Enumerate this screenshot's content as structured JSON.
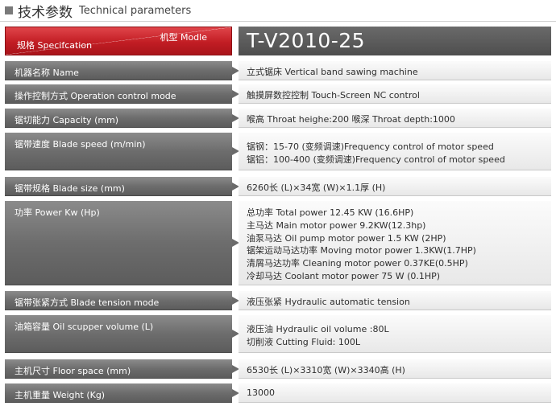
{
  "header": {
    "title_cn": "技术参数",
    "title_en": "Technical parameters"
  },
  "table": {
    "model_label": "机型 Modle",
    "spec_label": "规格 Specifcation",
    "model_name": "T-V2010-25",
    "rows": [
      {
        "label": "机器名称 Name",
        "values": [
          "立式锯床 Vertical band sawing machine"
        ]
      },
      {
        "label": "操作控制方式 Operation control mode",
        "values": [
          "触摸屏数控控制 Touch-Screen NC control"
        ]
      },
      {
        "label": "锯切能力 Capacity (mm)",
        "values": [
          "喉高 Throat heighe:200    喉深 Throat depth:1000"
        ]
      },
      {
        "label": "锯带速度 Blade speed (m/min)",
        "values": [
          "锯钢：15-70 (变频调速)Frequency control of motor speed",
          "锯铝：100-400 (变频调速)Frequency control of motor speed"
        ]
      },
      {
        "label": "锯带规格 Blade size (mm)",
        "values": [
          "6260长 (L)×34宽 (W)×1.1厚 (H)"
        ]
      },
      {
        "label": "功率 Power Kw (Hp)",
        "values": [
          "总功率 Total power 12.45 KW (16.6HP)",
          "主马达 Main motor power 9.2KW(12.3hp)",
          "油泵马达 Oil pump motor power 1.5 KW (2HP)",
          "锯架运动马达功率 Moving motor power 1.3KW(1.7HP)",
          "清屑马达功率 Cleaning motor power 0.37KE(0.5HP)",
          "冷却马达 Coolant motor power 75   W (0.1HP)"
        ]
      },
      {
        "label": "锯带张紧方式 Blade tension mode",
        "values": [
          "液压张紧 Hydraulic automatic tension"
        ]
      },
      {
        "label": "油箱容量 Oil scupper volume (L)",
        "values": [
          "液压油 Hydraulic oil volume :80L",
          "切削液 Cutting Fluid: 100L"
        ]
      },
      {
        "label": "主机尺寸 Floor space (mm)",
        "values": [
          "6530长 (L)×3310宽 (W)×3340高 (H)"
        ]
      },
      {
        "label": "主机重量 Weight (Kg)",
        "values": [
          "13000"
        ]
      }
    ]
  }
}
